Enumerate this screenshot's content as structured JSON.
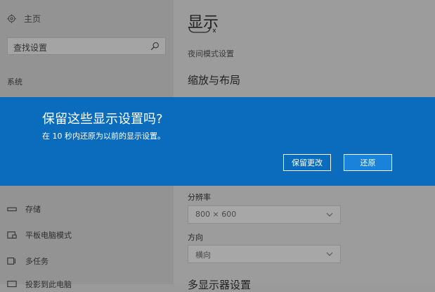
{
  "sidebar": {
    "home_label": "主页",
    "search_placeholder": "查找设置",
    "section_label": "系统",
    "items": [
      {
        "label": "存储",
        "icon": "storage-icon"
      },
      {
        "label": "平板电脑模式",
        "icon": "tablet-mode-icon"
      },
      {
        "label": "多任务",
        "icon": "multitasking-icon"
      },
      {
        "label": "投影到此电脑",
        "icon": "project-icon"
      }
    ]
  },
  "main": {
    "title": "显示",
    "night_mode_link": "夜间模式设置",
    "scale_heading": "缩放与布局",
    "resolution_label": "分辨率",
    "resolution_value": "800 × 600",
    "orientation_label": "方向",
    "orientation_value": "横向",
    "next_heading": "多显示器设置"
  },
  "dialog": {
    "title": "保留这些显示设置吗?",
    "message": "在 10 秒内还原为以前的显示设置。",
    "keep_button": "保留更改",
    "revert_button": "还原"
  },
  "colors": {
    "dialog_bg": "#0b6cbd",
    "revert_button_bg": "#1a82d8"
  }
}
